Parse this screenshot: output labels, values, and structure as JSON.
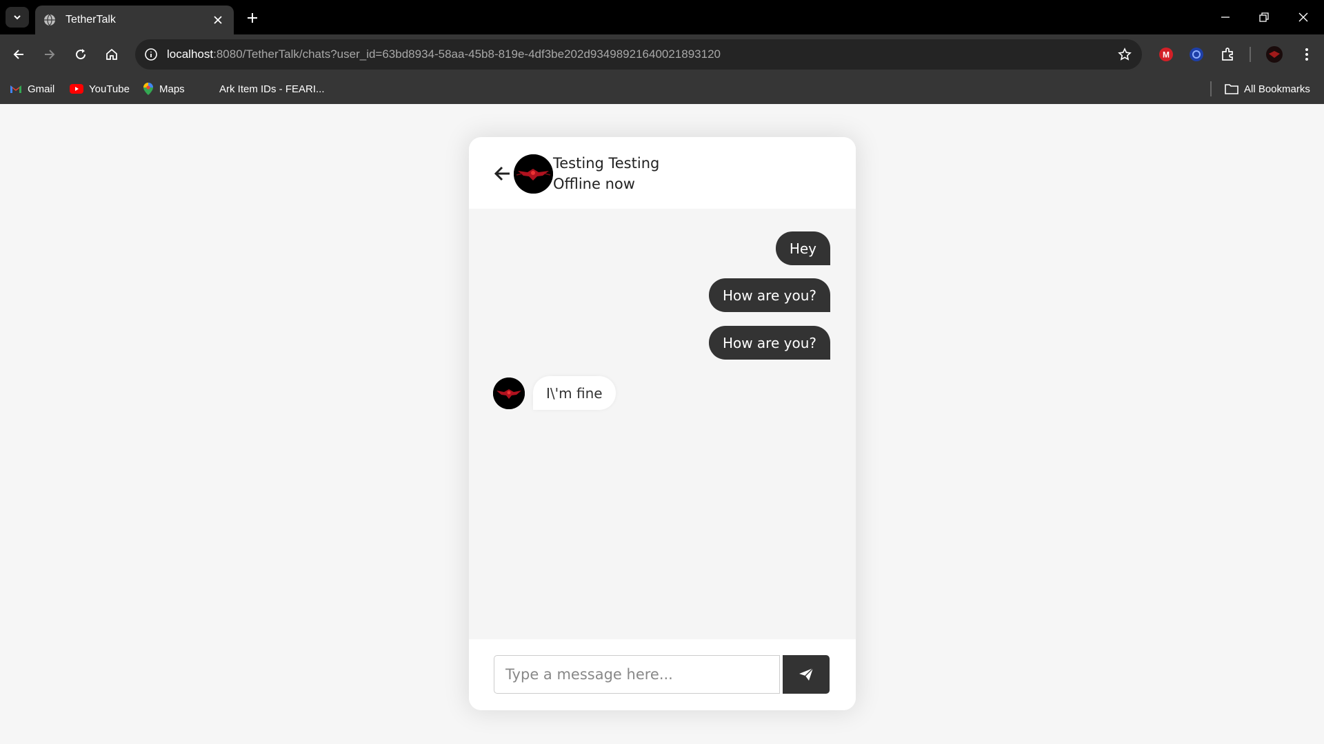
{
  "browser": {
    "tab_title": "TetherTalk",
    "url_host": "localhost",
    "url_rest": ":8080/TetherTalk/chats?user_id=63bd8934-58aa-45b8-819e-4df3be202d93498921640021893120",
    "bookmarks": [
      {
        "label": "Gmail",
        "icon": "gmail-icon"
      },
      {
        "label": "YouTube",
        "icon": "youtube-icon"
      },
      {
        "label": "Maps",
        "icon": "maps-icon"
      },
      {
        "label": "Ark Item IDs - FEARI...",
        "icon": "none"
      }
    ],
    "all_bookmarks_label": "All Bookmarks"
  },
  "chat": {
    "contact_name": "Testing Testing",
    "contact_status": "Offline now",
    "messages": [
      {
        "direction": "outgoing",
        "text": "Hey"
      },
      {
        "direction": "outgoing",
        "text": "How are you?"
      },
      {
        "direction": "outgoing",
        "text": "How are you?"
      },
      {
        "direction": "incoming",
        "text": "I\\'m fine"
      }
    ],
    "input_placeholder": "Type a message here..."
  },
  "colors": {
    "page_bg": "#f6f6f6",
    "bubble_out": "#333333",
    "bubble_in": "#ffffff",
    "send_button": "#333333",
    "avatar_accent": "#c8102e"
  }
}
